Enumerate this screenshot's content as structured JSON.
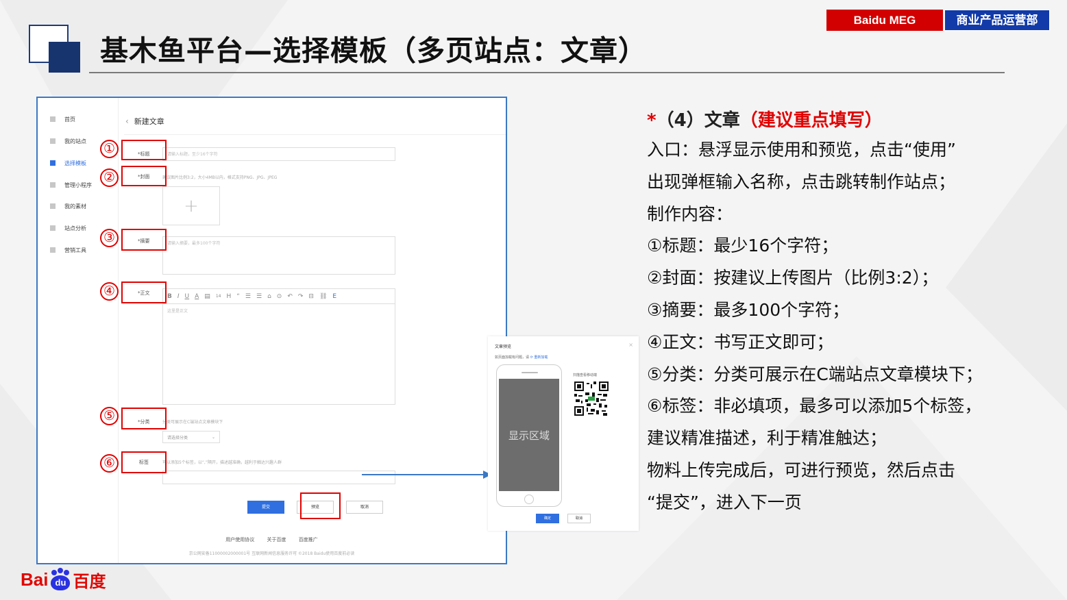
{
  "slide": {
    "title": "基木鱼平台—选择模板（多页站点：文章）",
    "badge_left": "Baidu MEG",
    "badge_right": "商业产品运营部",
    "colors": {
      "red": "#d20000",
      "blue": "#123aa8",
      "accent": "#2f6fe0",
      "navy": "#17346f"
    }
  },
  "screenshot": {
    "sidebar": [
      {
        "label": "首页",
        "active": false
      },
      {
        "label": "我的站点",
        "active": false
      },
      {
        "label": "选择模板",
        "active": true
      },
      {
        "label": "管理小程序",
        "active": false
      },
      {
        "label": "我的素材",
        "active": false
      },
      {
        "label": "站点分析",
        "active": false
      },
      {
        "label": "营销工具",
        "active": false
      }
    ],
    "header_back_icon": "chevron-left-icon",
    "header_title": "新建文章",
    "fields": {
      "title_label": "*标题",
      "title_placeholder": "请输入标题，至少16个字符",
      "cover_label": "*封面",
      "cover_hint": "建议图片比例3:2，大小4MB以内，格式支持PNG、JPG、JPEG",
      "cover_plus": "+",
      "summary_label": "*摘要",
      "summary_placeholder": "请输入摘要，最多100个字符",
      "body_label": "*正文",
      "body_toolbar": [
        "B",
        "I",
        "U",
        "A",
        "▤",
        "14",
        "H",
        "“",
        "☰",
        "☰",
        "⌂",
        "⊙",
        "↶",
        "↷",
        "⊟",
        "⛓",
        "E"
      ],
      "body_placeholder": "这里是正文",
      "category_label": "*分类",
      "category_hint": "分类可展示在C端站点文章模块下",
      "category_select": "请选择分类",
      "tags_label": "标签",
      "tags_hint": "可以添加5个标签，以“,”隔开，描述越准确，越利于触达兴趣人群"
    },
    "buttons": {
      "submit": "提交",
      "preview": "预览",
      "cancel": "取消"
    },
    "footer_links": [
      "用户使用协议",
      "关于百度",
      "百度推广"
    ],
    "footer_copy": "京公网安备11000002000001号  互联网新闻信息服务许可  ©2018 Baidu使用百度前必读",
    "markers": [
      "①",
      "②",
      "③",
      "④",
      "⑤",
      "⑥"
    ]
  },
  "preview_dialog": {
    "title": "文章预览",
    "close_icon": "close-icon",
    "notice": "如页面加载有问题，请",
    "refresh_link": "重新加载",
    "screen_text": "显示区域",
    "qr_label": "扫描查看移动端",
    "ok": "确定",
    "cancel": "取消"
  },
  "description": {
    "star": "*",
    "heading": "（4）文章",
    "suggestion": "（建议重点填写）",
    "lines": [
      "入口：悬浮显示使用和预览，点击“使用”",
      "出现弹框输入名称，点击跳转制作站点；",
      "制作内容：",
      "①标题：最少16个字符；",
      "②封面：按建议上传图片（比例3:2）；",
      "③摘要：最多100个字符；",
      "④正文：书写正文即可；",
      "⑤分类：分类可展示在C端站点文章模块下；",
      "⑥标签：非必填项，最多可以添加5个标签，",
      "建议精准描述，利于精准触达；",
      "物料上传完成后，可进行预览，然后点击",
      "“提交”，进入下一页"
    ]
  },
  "baidu_logo": {
    "bai": "Bai",
    "du": "du",
    "baidu_cn": "百度"
  }
}
